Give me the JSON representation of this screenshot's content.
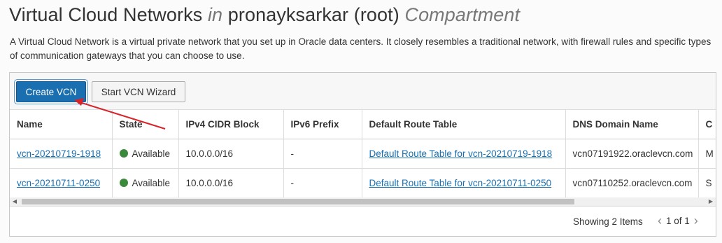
{
  "page": {
    "title_main": "Virtual Cloud Networks",
    "title_in": "in",
    "title_compartment_name": "pronayksarkar (root)",
    "title_compartment_word": "Compartment",
    "description": "A Virtual Cloud Network is a virtual private network that you set up in Oracle data centers. It closely resembles a traditional network, with firewall rules and specific types of communication gateways that you can choose to use."
  },
  "toolbar": {
    "create_label": "Create VCN",
    "wizard_label": "Start VCN Wizard"
  },
  "table": {
    "columns": [
      "Name",
      "State",
      "IPv4 CIDR Block",
      "IPv6 Prefix",
      "Default Route Table",
      "DNS Domain Name",
      "C"
    ],
    "rows": [
      {
        "name": "vcn-20210719-1918",
        "state": "Available",
        "cidr": "10.0.0.0/16",
        "ipv6": "-",
        "route_table": "Default Route Table for vcn-20210719-1918",
        "dns": "vcn07191922.oraclevcn.com",
        "extra": "M"
      },
      {
        "name": "vcn-20210711-0250",
        "state": "Available",
        "cidr": "10.0.0.0/16",
        "ipv6": "-",
        "route_table": "Default Route Table for vcn-20210711-0250",
        "dns": "vcn07110252.oraclevcn.com",
        "extra": "S"
      }
    ]
  },
  "footer": {
    "showing": "Showing 2 Items",
    "page_info": "1 of 1"
  },
  "colors": {
    "primary": "#1a6fb0",
    "available_dot": "#3b8a3b",
    "annotation_arrow": "#d9232a"
  }
}
